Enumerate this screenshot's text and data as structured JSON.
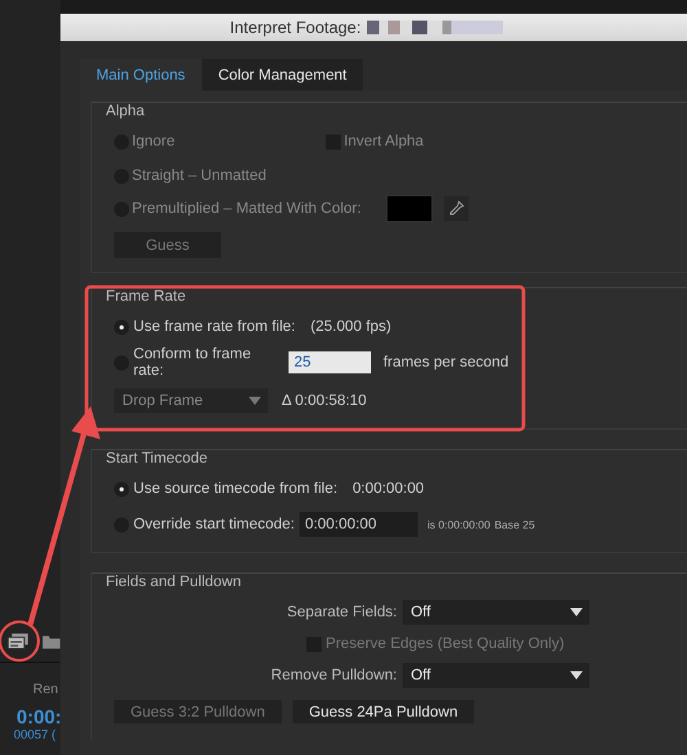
{
  "app_panel": {
    "label": "Ren",
    "timecode": "0:00:",
    "frame_count": "00057 ("
  },
  "dialog": {
    "title": "Interpret Footage:"
  },
  "tabs": [
    {
      "label": "Main Options",
      "selected": true
    },
    {
      "label": "Color Management",
      "selected": false
    }
  ],
  "alpha": {
    "title": "Alpha",
    "disabled": true,
    "options": [
      {
        "label": "Ignore",
        "selected": false
      },
      {
        "label": "Straight – Unmatted",
        "selected": false
      },
      {
        "label": "Premultiplied – Matted With Color:",
        "selected": false
      }
    ],
    "invert": {
      "label": "Invert Alpha",
      "checked": false
    },
    "guess_button": "Guess"
  },
  "frame_rate": {
    "title": "Frame Rate",
    "options": [
      {
        "label": "Use frame rate from file:",
        "selected": true,
        "value": "(25.000 fps)"
      },
      {
        "label": "Conform to frame rate:",
        "selected": false
      }
    ],
    "conform_value": "25",
    "units": "frames per second",
    "drop_frame": "Drop Frame",
    "duration": "Δ 0:00:58:10"
  },
  "start_timecode": {
    "title": "Start Timecode",
    "options": [
      {
        "label": "Use source timecode from file:",
        "selected": true,
        "value": "0:00:00:00"
      },
      {
        "label": "Override start timecode:",
        "selected": false
      }
    ],
    "override_value": "0:00:00:00",
    "note": "is 0:00:00:00",
    "base": "Base 25"
  },
  "fields": {
    "title": "Fields and Pulldown",
    "separate_fields": {
      "label": "Separate Fields:",
      "value": "Off"
    },
    "preserve_edges": {
      "label": "Preserve Edges (Best Quality Only)",
      "checked": false
    },
    "remove_pulldown": {
      "label": "Remove Pulldown:",
      "value": "Off"
    },
    "buttons": [
      {
        "label": "Guess 3:2 Pulldown",
        "disabled": true
      },
      {
        "label": "Guess 24Pa Pulldown",
        "disabled": false
      }
    ]
  }
}
